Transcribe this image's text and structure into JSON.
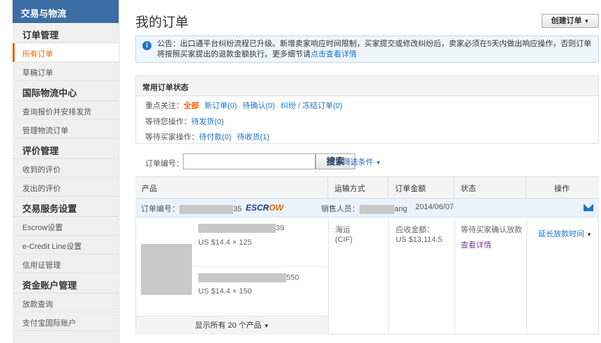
{
  "sidebar": {
    "top": "交易与物流",
    "sections": [
      {
        "title": "订单管理",
        "items": [
          "所有订单",
          "草稿订单"
        ]
      },
      {
        "title": "国际物流中心",
        "items": [
          "查询报价并安排发货",
          "管理物流订单"
        ]
      },
      {
        "title": "评价管理",
        "items": [
          "收到的评价",
          "发出的评价"
        ]
      },
      {
        "title": "交易服务设置",
        "items": [
          "Escrow设置",
          "e-Credit Line设置",
          "信用证管理"
        ]
      },
      {
        "title": "资金账户管理",
        "items": [
          "放款查询",
          "支付宝国际账户"
        ]
      }
    ]
  },
  "header": {
    "title": "我的订单",
    "create_label": "创建订单"
  },
  "notice": {
    "text": "公告：出口通平台纠纷流程已升级。新增卖家响应时间限制，买家提交或修改纠纷后，卖家必须在5天内做出响应操作，否则订单将按照买家提出的退款金额执行。更多细节请",
    "link": "点击查看详情"
  },
  "status": {
    "title": "常用订单状态",
    "focus_label": "重点关注：",
    "focus_all": "全部",
    "focus_new": "新订单(0)",
    "focus_confirm": "待确认(0)",
    "focus_dispute": "纠纷 / 冻结订单(0)",
    "wait_you_label": "等待您操作：",
    "wait_ship": "待发货(0)",
    "wait_buyer_label": "等待买家操作：",
    "wait_pay": "待付款(0)",
    "wait_receive": "待收货(1)"
  },
  "search": {
    "label": "订单编号：",
    "value": "",
    "button": "搜索",
    "more": "更多筛选条件"
  },
  "table": {
    "col_product": "产品",
    "col_ship": "运输方式",
    "col_amount": "订单金额",
    "col_status": "状态",
    "col_action": "操作"
  },
  "order": {
    "id_label": "订单编号：",
    "id_suffix": "35",
    "escrow_main": "ESCR",
    "escrow_ow": "OW",
    "sales_label": "销售人员：",
    "sales_suffix": "ang",
    "date": "2014/06/07",
    "products": [
      {
        "code_suffix": "39",
        "price": "US $14.4 × 125"
      },
      {
        "code_suffix": "550",
        "price": "US $14.4 × 150"
      }
    ],
    "show_all": "显示所有 20 个产品",
    "ship_method": "海运",
    "ship_term": "(CIF)",
    "amount_label": "应收金额：",
    "amount": "US $13,114.5",
    "status_text": "等待买家确认放款",
    "view_detail": "查看详情",
    "action": "延长放款时间"
  }
}
